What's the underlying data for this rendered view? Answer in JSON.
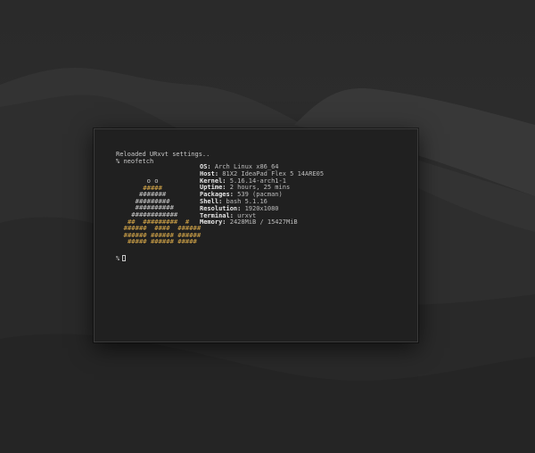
{
  "terminal": {
    "line1": "Reloaded URxvt settings..",
    "prompt_symbol": "%",
    "command": "neofetch",
    "art": [
      "        o o",
      "       #####",
      "      #######",
      "     #########",
      "     ##########",
      "    ############",
      "   ##  #########  #",
      "  ######  ####  ######",
      "  ###### ###### ######",
      "   ##### ###### #####"
    ],
    "info": [
      {
        "key": "OS:",
        "value": "Arch Linux x86_64"
      },
      {
        "key": "Host:",
        "value": "81X2 IdeaPad Flex 5 14ARE05"
      },
      {
        "key": "Kernel:",
        "value": "5.16.14-arch1-1"
      },
      {
        "key": "Uptime:",
        "value": "2 hours, 25 mins"
      },
      {
        "key": "Packages:",
        "value": "539 (pacman)"
      },
      {
        "key": "Shell:",
        "value": "bash 5.1.16"
      },
      {
        "key": "Resolution:",
        "value": "1920x1080"
      },
      {
        "key": "Terminal:",
        "value": "urxvt"
      },
      {
        "key": "Memory:",
        "value": "2428MiB / 15427MiB"
      }
    ]
  },
  "colors": {
    "background": "#202020",
    "text": "#c9c9c9",
    "accent": "#d8a94a"
  }
}
